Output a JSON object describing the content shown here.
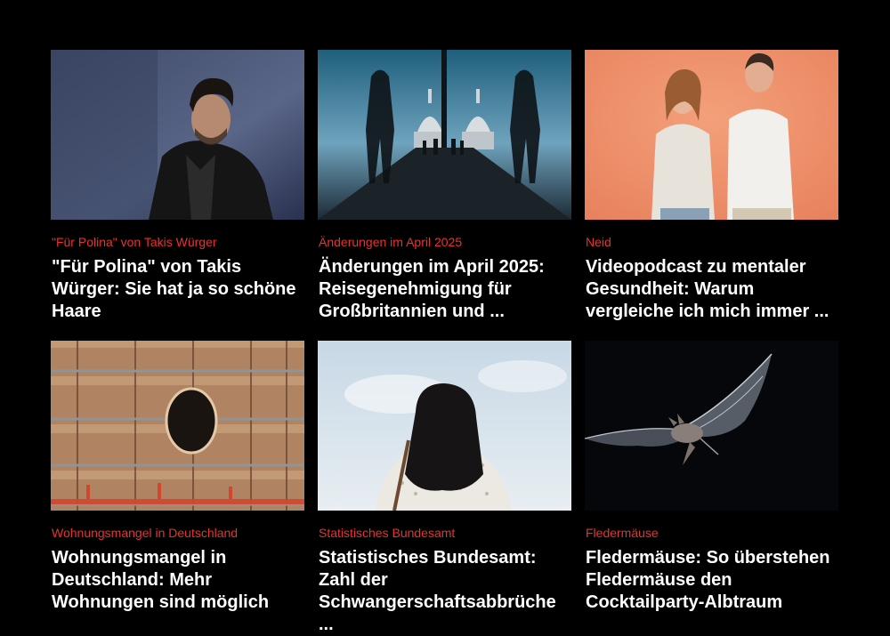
{
  "articles": [
    {
      "kicker": "\"Für Polina\" von Takis Würger",
      "headline": "\"Für Polina\" von Takis Würger: Sie hat ja so schöne Haare",
      "image": "portrait-man-dark-jacket"
    },
    {
      "kicker": "Änderungen im April 2025",
      "headline": "Änderungen im April 2025: Reisegenehmigung für Großbritannien und ...",
      "image": "millennium-bridge-st-pauls"
    },
    {
      "kicker": "Neid",
      "headline": "Videopodcast zu mentaler Gesundheit: Warum vergleiche ich mich immer ...",
      "image": "two-podcast-hosts-orange"
    },
    {
      "kicker": "Wohnungsmangel in Deutschland",
      "headline": "Wohnungsmangel in Deutschland: Mehr Wohnungen sind möglich",
      "image": "scaffolding-building-facade"
    },
    {
      "kicker": "Statistisches Bundesamt",
      "headline": "Statistisches Bundesamt: Zahl der Schwangerschaftsabbrüche ...",
      "image": "woman-from-behind-sky"
    },
    {
      "kicker": "Fledermäuse",
      "headline": "Fledermäuse: So überstehen Fledermäuse den Cocktailparty-Albtraum",
      "image": "bat-in-flight"
    }
  ],
  "colors": {
    "background": "#000000",
    "kicker": "#e8322f",
    "headline": "#ffffff"
  }
}
